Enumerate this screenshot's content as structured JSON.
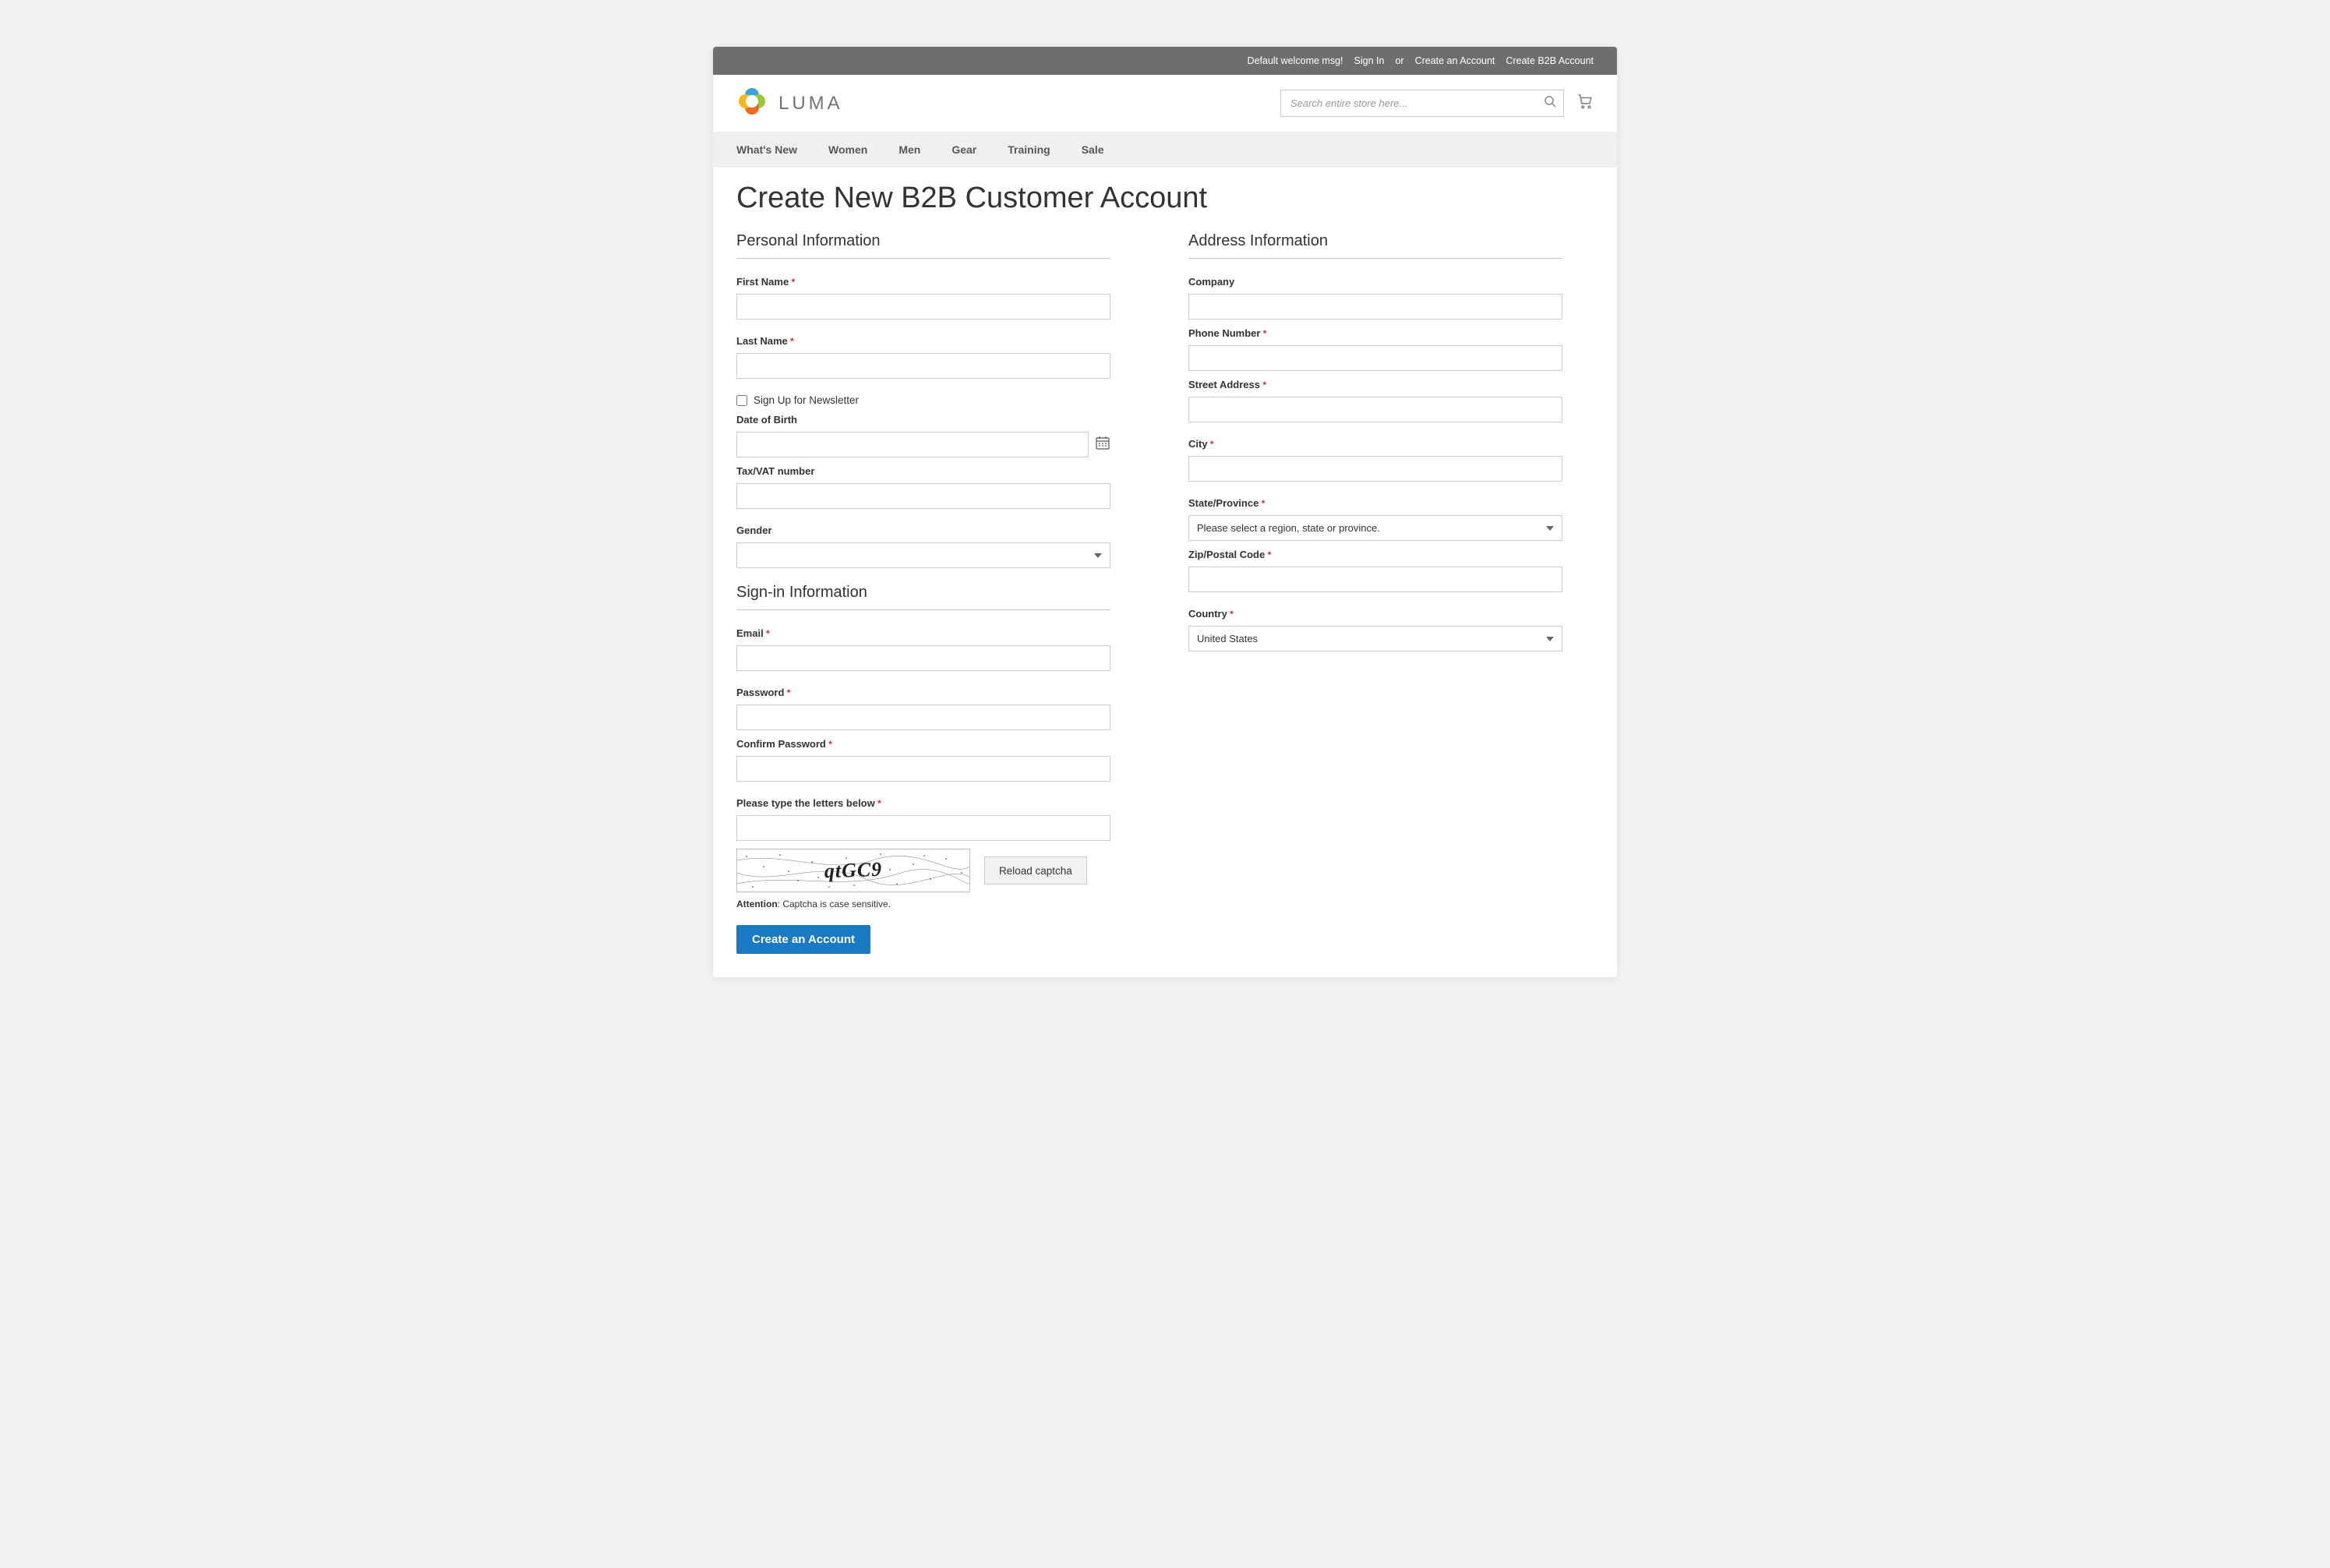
{
  "topbar": {
    "welcome": "Default welcome msg!",
    "sign_in": "Sign In",
    "or": "or",
    "create_account": "Create an Account",
    "create_b2b": "Create B2B Account"
  },
  "header": {
    "logo_text": "LUMA",
    "search_placeholder": "Search entire store here..."
  },
  "nav": {
    "items": [
      "What's New",
      "Women",
      "Men",
      "Gear",
      "Training",
      "Sale"
    ]
  },
  "page": {
    "title": "Create New B2B Customer Account"
  },
  "personal": {
    "section_title": "Personal Information",
    "first_name": "First Name",
    "last_name": "Last Name",
    "newsletter": "Sign Up for Newsletter",
    "dob": "Date of Birth",
    "taxvat": "Tax/VAT number",
    "gender": "Gender"
  },
  "signin": {
    "section_title": "Sign-in Information",
    "email": "Email",
    "password": "Password",
    "confirm_password": "Confirm Password",
    "captcha_label": "Please type the letters below",
    "captcha_value": "qtGC9",
    "reload": "Reload captcha",
    "attention_prefix": "Attention",
    "attention_text": ": Captcha is case sensitive."
  },
  "address": {
    "section_title": "Address Information",
    "company": "Company",
    "phone": "Phone Number",
    "street": "Street Address",
    "city": "City",
    "state": "State/Province",
    "state_placeholder": "Please select a region, state or province.",
    "zip": "Zip/Postal Code",
    "country": "Country",
    "country_value": "United States"
  },
  "submit": {
    "label": "Create an Account"
  }
}
